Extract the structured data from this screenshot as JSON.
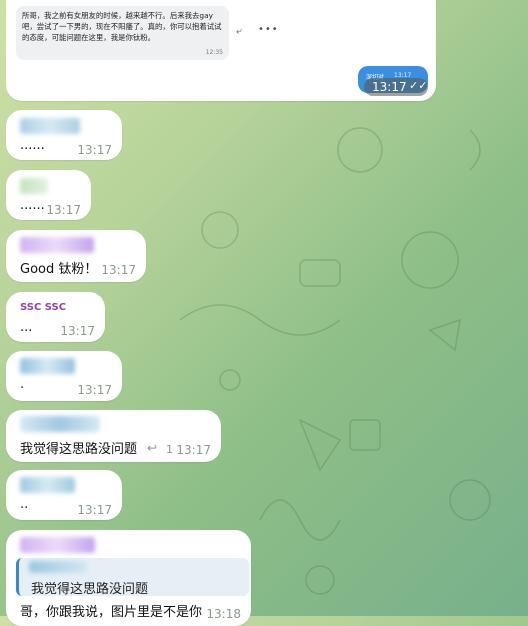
{
  "top_message": {
    "forwarded_text": "所哥，我之前有女朋友的时候，越来越不行。后来我去gay吧，尝试了一下男的，现在不阳痿了。真的，你可以抱着试试的态度，可能问题在这里，我是你钛粉。",
    "forwarded_time": "12:35",
    "react_icon": "reply-icon",
    "more_icon": "more-dots-icon",
    "sent_label": "深切对",
    "sent_time": "13:17",
    "time": "13:17"
  },
  "messages": [
    {
      "text": "......",
      "time": "13:17"
    },
    {
      "text": "......",
      "time": "13:17"
    },
    {
      "text": "Good 钛粉！",
      "time": "13:17"
    },
    {
      "name": "SSC SSC",
      "text": "...",
      "time": "13:17"
    },
    {
      "text": ".",
      "time": "13:17"
    },
    {
      "text": "我觉得这思路没问题",
      "reply_count": "1",
      "time": "13:17"
    },
    {
      "text": "..",
      "time": "13:17"
    },
    {
      "quote": "我觉得这思路没问题",
      "text": "哥，你跟我说，图片里是不是你",
      "time": "13:18"
    }
  ],
  "colors": {
    "background": "#a7c894",
    "bubble": "#ffffff",
    "accent": "#3a86d0",
    "name": "#8e44ad",
    "time": "#8a9a8a"
  }
}
